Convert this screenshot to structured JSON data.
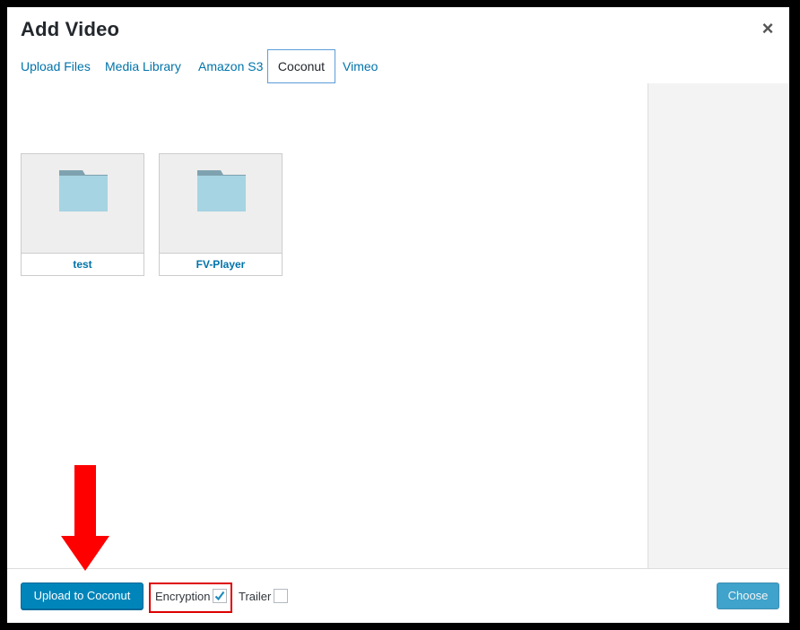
{
  "dialog": {
    "title": "Add Video",
    "close_glyph": "×"
  },
  "tabs": [
    {
      "label": "Upload Files",
      "active": false
    },
    {
      "label": "Media Library",
      "active": false
    },
    {
      "label": "Amazon S3",
      "active": false
    },
    {
      "label": "Coconut",
      "active": true
    },
    {
      "label": "Vimeo",
      "active": false
    }
  ],
  "folders": [
    {
      "name": "test",
      "icon": "folder-icon"
    },
    {
      "name": "FV-Player",
      "icon": "folder-icon"
    }
  ],
  "footer": {
    "upload_button": "Upload to Coconut",
    "encryption_label": "Encryption",
    "encryption_checked": true,
    "trailer_label": "Trailer",
    "trailer_checked": false,
    "choose_button": "Choose"
  },
  "colors": {
    "accent": "#0073aa",
    "primary_button": "#0085ba",
    "highlight_box": "#dd0000",
    "annotation_arrow": "#ff0000",
    "folder_fill": "#a6d4e2",
    "folder_tab": "#7fa2b0"
  }
}
